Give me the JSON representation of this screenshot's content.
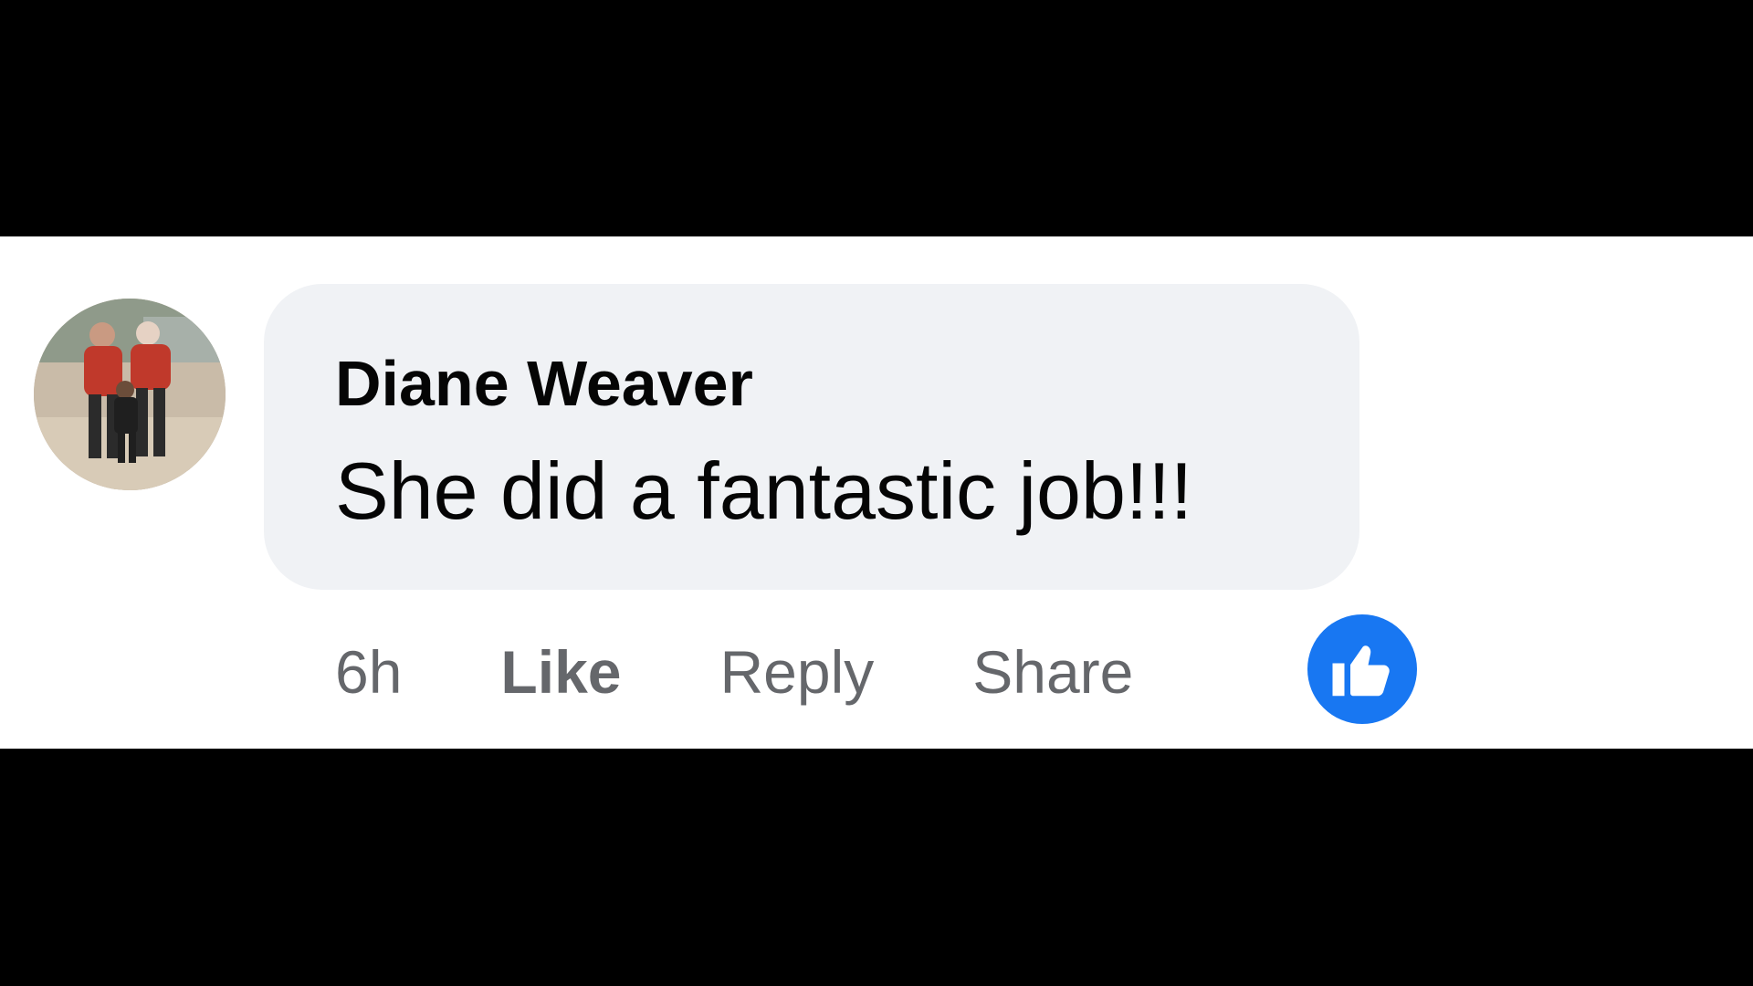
{
  "comment": {
    "author": "Diane Weaver",
    "text": "She did a fantastic job!!!",
    "timestamp": "6h",
    "actions": {
      "like": "Like",
      "reply": "Reply",
      "share": "Share"
    },
    "reaction": {
      "icon": "thumbs-up-icon",
      "color": "#1877f2"
    },
    "avatar": {
      "icon": "profile-photo"
    }
  },
  "colors": {
    "bubble_background": "#f0f2f5",
    "text_primary": "#050505",
    "text_secondary": "#65676b",
    "accent": "#1877f2"
  }
}
